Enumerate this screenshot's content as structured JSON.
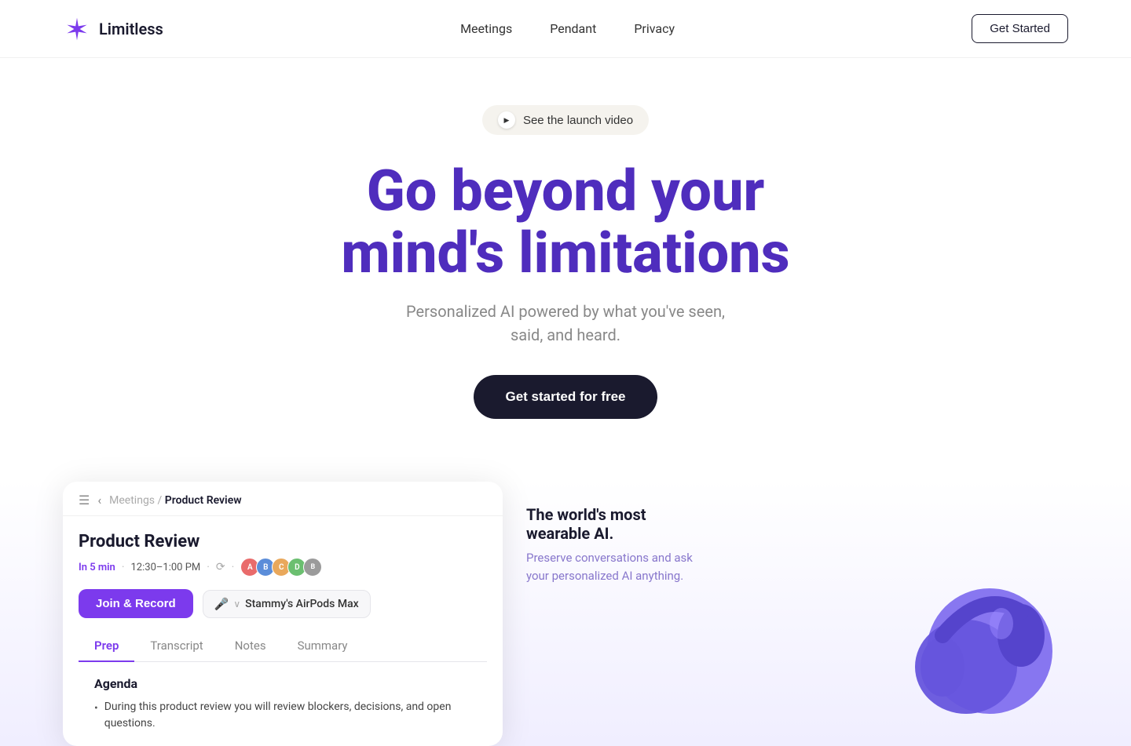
{
  "nav": {
    "logo_text": "Limitless",
    "links": [
      "Meetings",
      "Pendant",
      "Privacy"
    ],
    "cta": "Get Started"
  },
  "hero": {
    "badge": {
      "text": "See the launch video",
      "play_icon": "▶"
    },
    "title_line1": "Go beyond your",
    "title_line2": "mind's limitations",
    "subtitle": "Personalized AI powered by what you've seen, said, and heard.",
    "cta": "Get started for free"
  },
  "app_demo": {
    "breadcrumb_parent": "Meetings",
    "breadcrumb_separator": "/",
    "breadcrumb_current": "Product Review",
    "meeting_title": "Product Review",
    "time_badge": "In 5 min",
    "time_range": "12:30–1:00 PM",
    "join_record_label": "Join & Record",
    "audio_device": "Stammy's AirPods Max",
    "tabs": [
      "Prep",
      "Transcript",
      "Notes",
      "Summary"
    ],
    "active_tab": "Prep",
    "agenda_heading": "Agenda",
    "agenda_item": "During this product review you will review blockers, decisions, and open questions."
  },
  "right_panel": {
    "title": "The world's most wearable AI.",
    "subtitle": "Preserve conversations and ask your personalized AI anything."
  },
  "icons": {
    "hamburger": "☰",
    "back": "‹",
    "play": "▶",
    "mic": "🎤",
    "chevron_down": "∨",
    "sync": "⟳",
    "bullet": "•"
  }
}
